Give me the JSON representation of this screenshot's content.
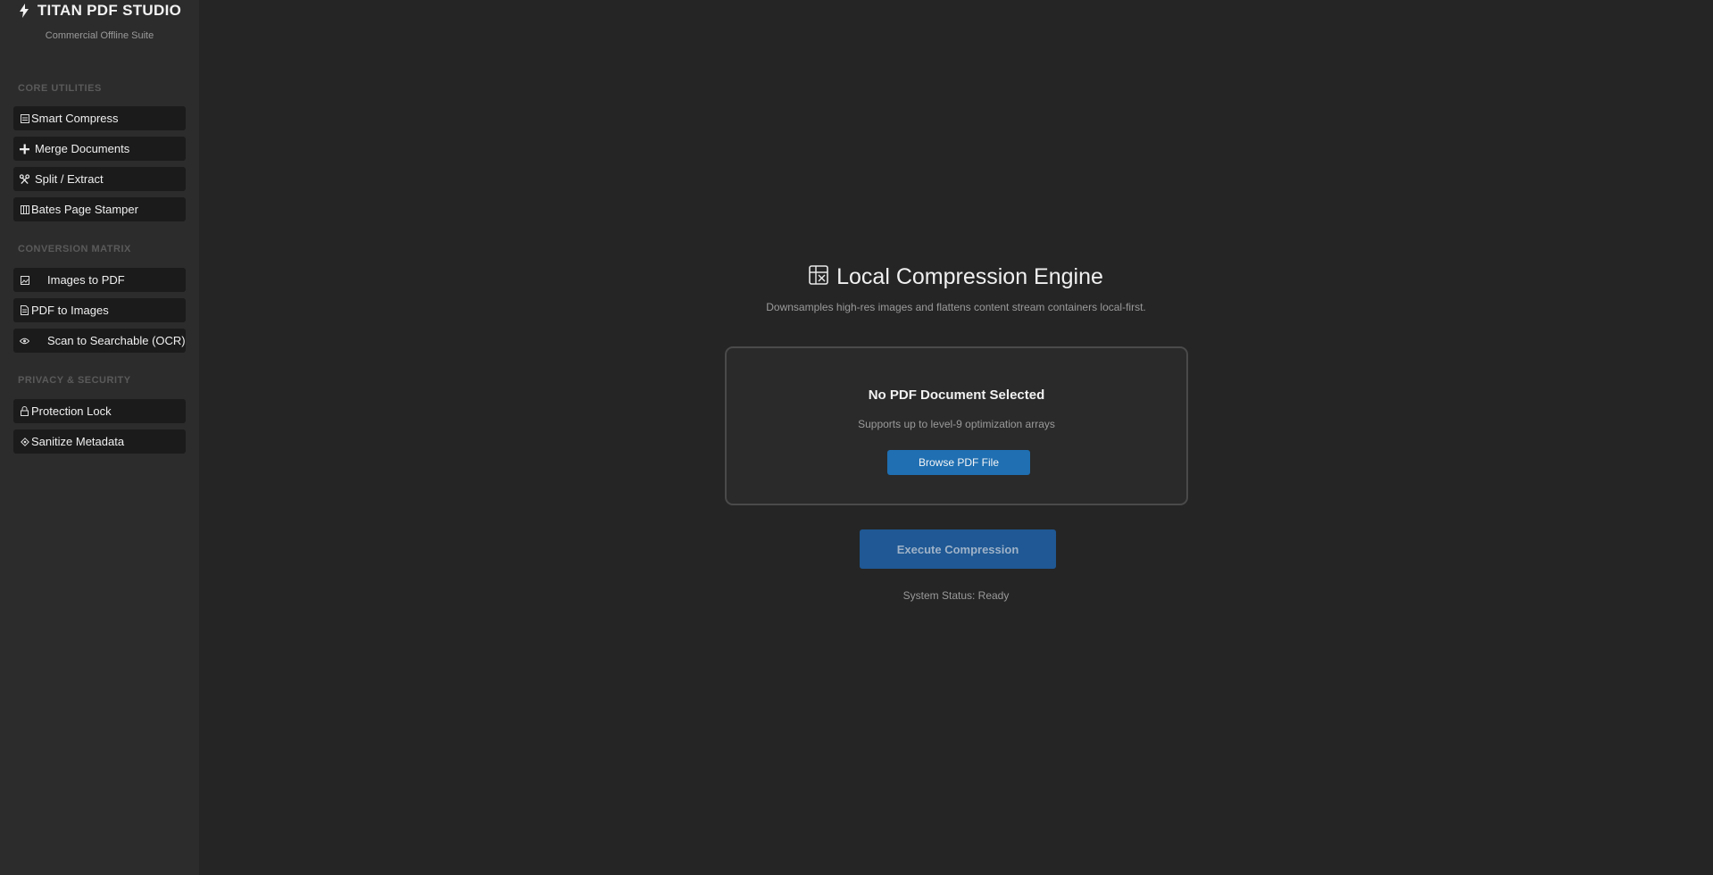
{
  "sidebar": {
    "brand": {
      "title": "TITAN PDF STUDIO",
      "subtitle": "Commercial Offline Suite",
      "icon": "lightning-icon"
    },
    "sections": [
      {
        "title": "CORE UTILITIES",
        "items": [
          {
            "label": "Smart Compress",
            "icon": "compress-icon"
          },
          {
            "label": "Merge Documents",
            "icon": "plus-icon"
          },
          {
            "label": "Split / Extract",
            "icon": "scissors-icon"
          },
          {
            "label": "Bates Page Stamper",
            "icon": "stamper-icon"
          }
        ]
      },
      {
        "title": "CONVERSION MATRIX",
        "items": [
          {
            "label": "Images to PDF",
            "icon": "image-icon"
          },
          {
            "label": "PDF to Images",
            "icon": "document-icon"
          },
          {
            "label": "Scan to Searchable (OCR)",
            "icon": "eye-icon"
          }
        ]
      },
      {
        "title": "PRIVACY & SECURITY",
        "items": [
          {
            "label": "Protection Lock",
            "icon": "lock-icon"
          },
          {
            "label": "Sanitize Metadata",
            "icon": "sanitize-icon"
          }
        ]
      }
    ]
  },
  "main": {
    "title": "Local Compression Engine",
    "title_icon": "compress-grid-icon",
    "description": "Downsamples high-res images and flattens content stream containers local-first.",
    "dropzone": {
      "title": "No PDF Document Selected",
      "subtitle": "Supports up to level-9 optimization arrays",
      "browse_label": "Browse PDF File"
    },
    "execute_label": "Execute Compression",
    "status": "System Status: Ready"
  },
  "colors": {
    "sidebar_bg": "#2c2c2c",
    "main_bg": "#252525",
    "nav_item_bg": "#1b1b1b",
    "primary_button": "#1f6fb2",
    "execute_button": "#1f5894",
    "section_title": "#5a5a5a"
  }
}
